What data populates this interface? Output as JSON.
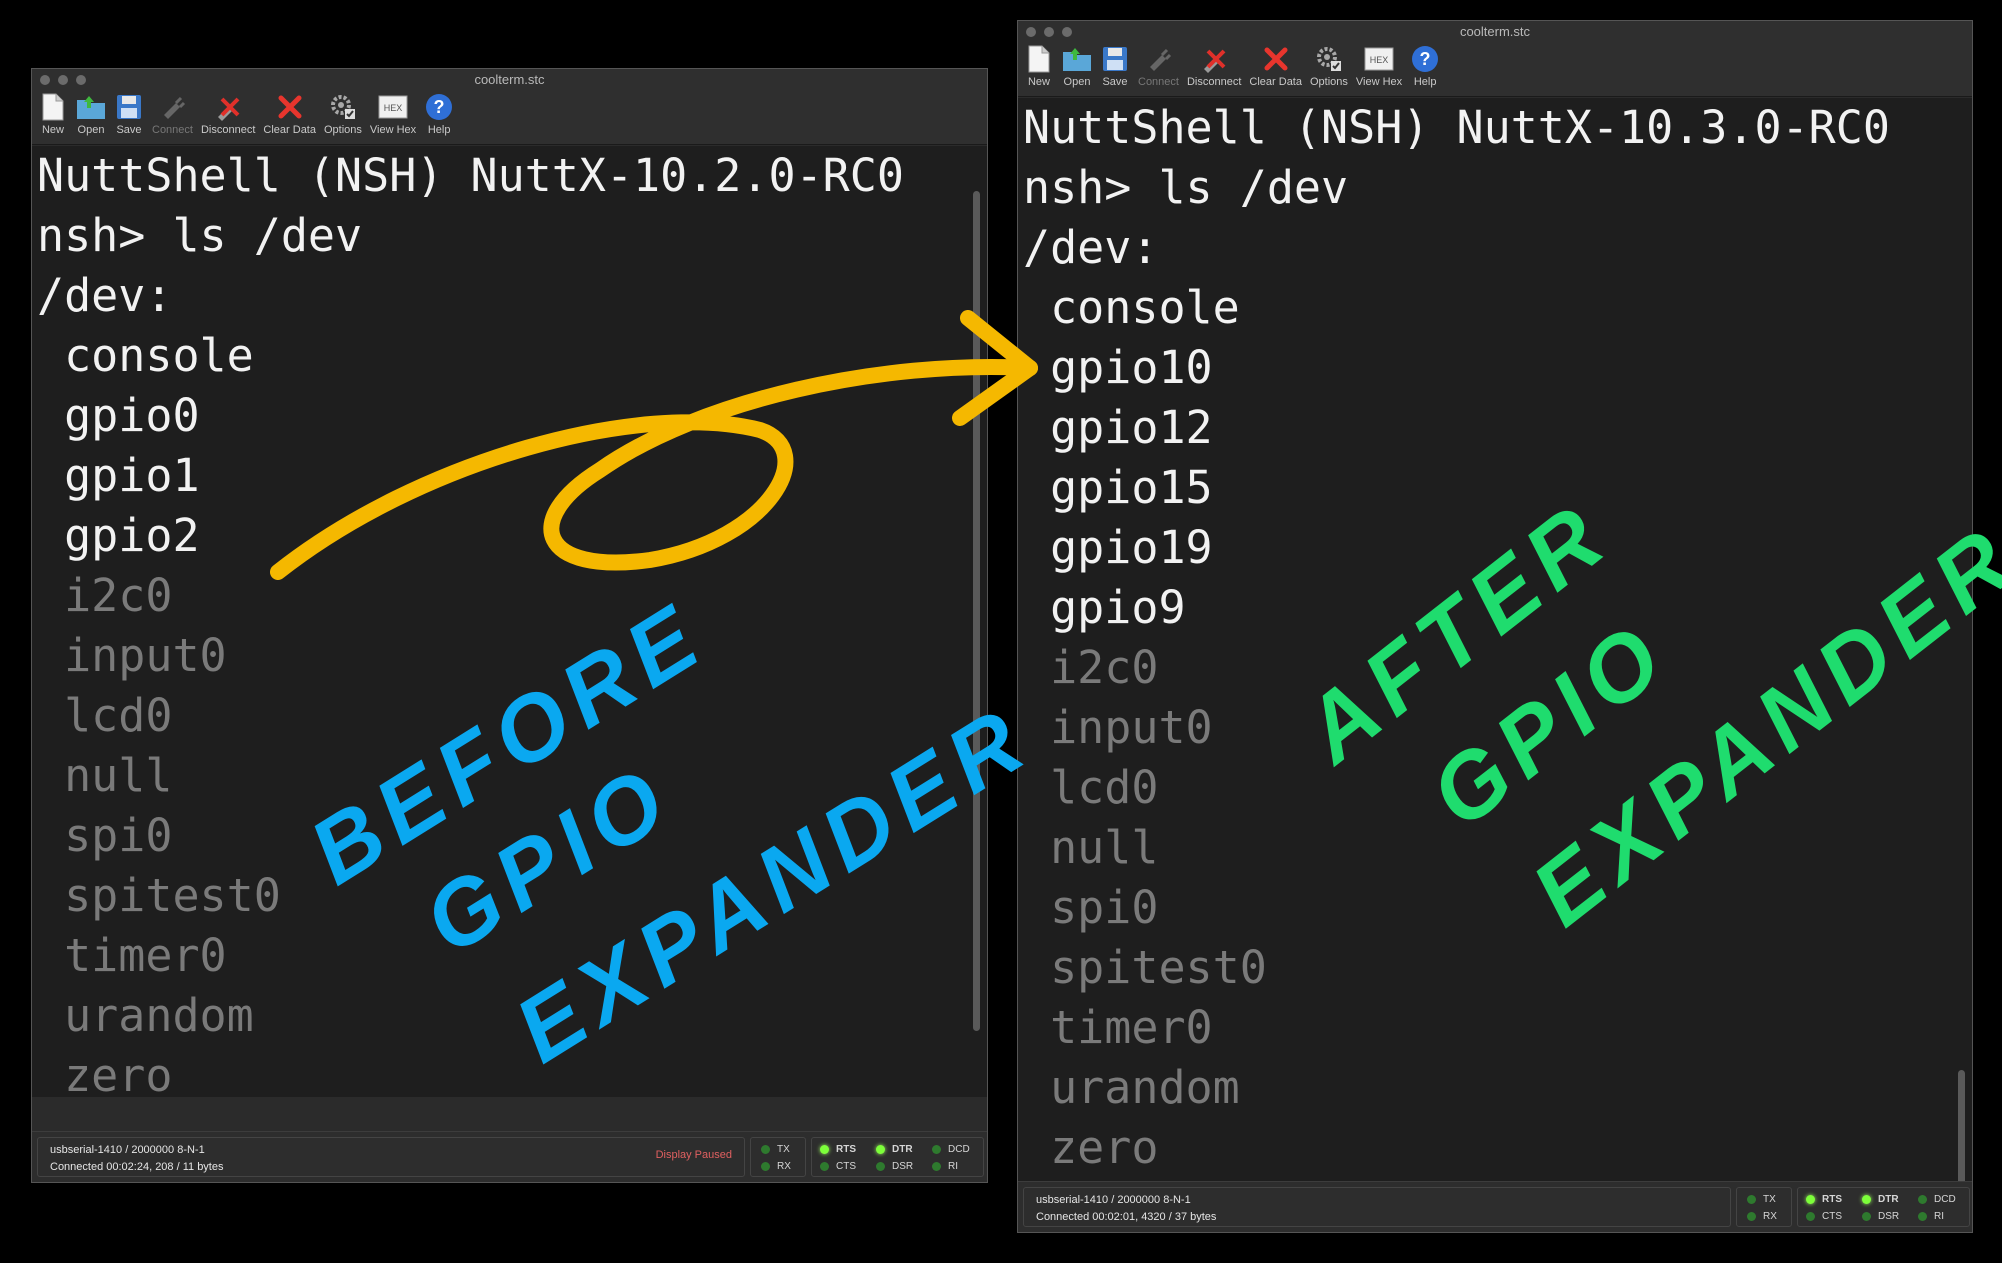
{
  "left": {
    "title": "coolterm.stc",
    "toolbar": {
      "new": "New",
      "open": "Open",
      "save": "Save",
      "connect": "Connect",
      "disconnect": "Disconnect",
      "clear": "Clear Data",
      "options": "Options",
      "viewhex": "View Hex",
      "help": "Help",
      "hex_icon_text": "HEX"
    },
    "lines": [
      "NuttShell (NSH) NuttX-10.2.0-RC0",
      "nsh> ls /dev",
      "/dev:",
      " console",
      " gpio0",
      " gpio1",
      " gpio2",
      " i2c0",
      " input0",
      " lcd0",
      " null",
      " spi0",
      " spitest0",
      " timer0",
      " urandom",
      " zero"
    ],
    "status": {
      "port": "usbserial-1410 / 2000000 8-N-1",
      "connection": "Connected 00:02:24, 208 / 11 bytes",
      "paused": "Display Paused"
    }
  },
  "right": {
    "title": "coolterm.stc",
    "toolbar": {
      "new": "New",
      "open": "Open",
      "save": "Save",
      "connect": "Connect",
      "disconnect": "Disconnect",
      "clear": "Clear Data",
      "options": "Options",
      "viewhex": "View Hex",
      "help": "Help",
      "hex_icon_text": "HEX"
    },
    "lines": [
      "NuttShell (NSH) NuttX-10.3.0-RC0",
      "nsh> ls /dev",
      "/dev:",
      " console",
      " gpio10",
      " gpio12",
      " gpio15",
      " gpio19",
      " gpio9",
      " i2c0",
      " input0",
      " lcd0",
      " null",
      " spi0",
      " spitest0",
      " timer0",
      " urandom",
      " zero"
    ],
    "status": {
      "port": "usbserial-1410 / 2000000 8-N-1",
      "connection": "Connected 00:02:01, 4320 / 37 bytes"
    }
  },
  "indicators": {
    "tx": "TX",
    "rx": "RX",
    "rts": "RTS",
    "cts": "CTS",
    "dtr": "DTR",
    "dsr": "DSR",
    "dcd": "DCD",
    "ri": "RI"
  },
  "annotations": {
    "left": [
      "BEFORE",
      "GPIO",
      "EXPANDER"
    ],
    "right": [
      "AFTER",
      "GPIO",
      "EXPANDER"
    ],
    "left_color": "#0aa8f0",
    "right_color": "#1fdc6e",
    "arrow_color": "#f5b800"
  }
}
